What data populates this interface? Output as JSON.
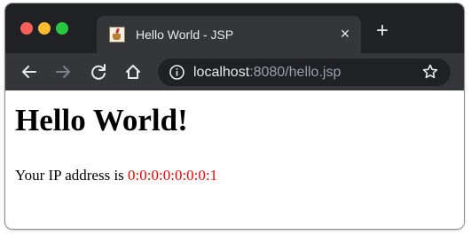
{
  "browser": {
    "tab": {
      "title": "Hello World - JSP",
      "favicon": "java-coffee-cup-icon"
    },
    "address": {
      "host": "localhost",
      "rest": ":8080/hello.jsp"
    },
    "icons": {
      "back": "back-arrow-icon",
      "forward": "forward-arrow-icon",
      "reload": "reload-icon",
      "home": "home-icon",
      "info": "info-icon",
      "bookmark": "star-icon",
      "close_tab": "close-icon",
      "new_tab": "plus-icon"
    },
    "glyphs": {
      "close_tab": "×",
      "new_tab": "+"
    },
    "colors": {
      "frame": "#202124",
      "toolbar": "#35363a",
      "close_light": "#ff5f57",
      "minimize_light": "#febc2e",
      "maximize_light": "#28c840"
    }
  },
  "page": {
    "heading": "Hello World!",
    "ip_label": "Your IP address is",
    "ip_value": "0:0:0:0:0:0:0:1",
    "colors": {
      "ip_value": "#ff0000"
    }
  }
}
